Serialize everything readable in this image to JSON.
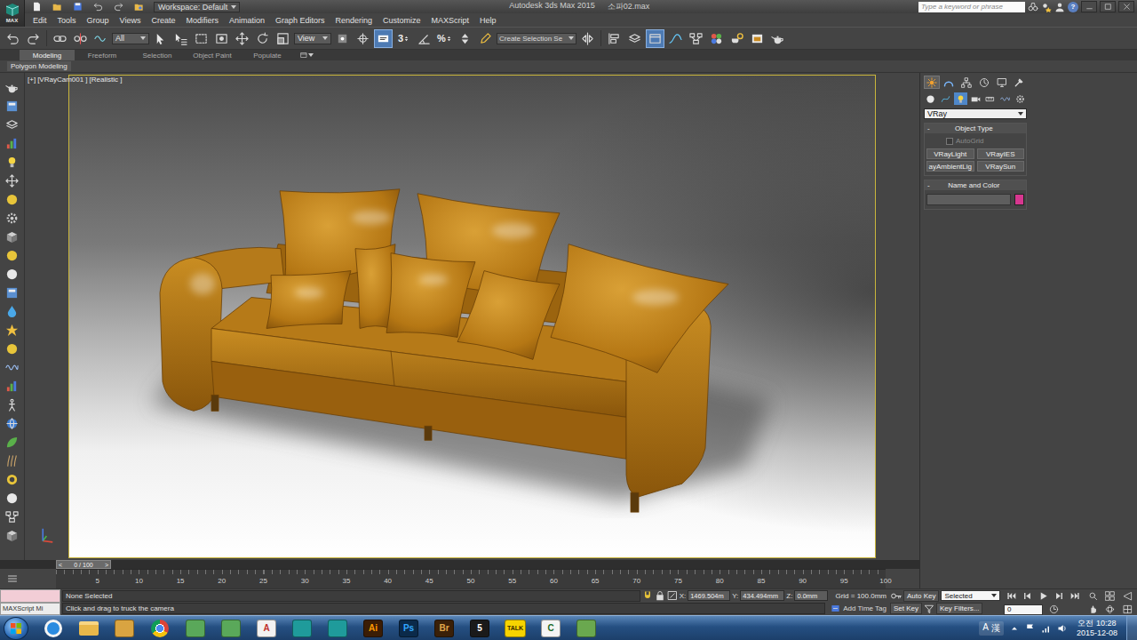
{
  "app_button": {
    "label": "MAX"
  },
  "title_bar": {
    "quick_access": [
      {
        "kind": "new"
      },
      {
        "kind": "open"
      },
      {
        "kind": "save"
      },
      {
        "kind": "undo"
      },
      {
        "kind": "redo"
      },
      {
        "kind": "project"
      }
    ],
    "workspace": "Workspace: Default",
    "title": "Autodesk 3ds Max  2015",
    "file": "소파02.max",
    "search_placeholder": "Type a keyword or phrase",
    "help": "?"
  },
  "menu": [
    "Edit",
    "Tools",
    "Group",
    "Views",
    "Create",
    "Modifiers",
    "Animation",
    "Graph Editors",
    "Rendering",
    "Customize",
    "MAXScript",
    "Help"
  ],
  "toolbar": [
    {
      "kind": "undo",
      "active": false
    },
    {
      "kind": "redo",
      "active": false
    },
    {
      "kind": "link",
      "active": false
    },
    {
      "kind": "unlink",
      "active": false
    },
    {
      "kind": "bind",
      "active": false
    },
    {
      "kind": "dropdown",
      "label": "All",
      "active": false
    },
    {
      "kind": "select",
      "active": false
    },
    {
      "kind": "select-name",
      "active": false
    },
    {
      "kind": "region",
      "active": false
    },
    {
      "kind": "crossing",
      "active": false
    },
    {
      "kind": "move",
      "active": false
    },
    {
      "kind": "rotate",
      "active": false
    },
    {
      "kind": "scale",
      "active": false
    },
    {
      "kind": "dropdown",
      "label": "View",
      "active": false
    },
    {
      "kind": "pivot",
      "active": false
    },
    {
      "kind": "manipulate",
      "active": false
    },
    {
      "kind": "keyboard",
      "active": true
    },
    {
      "kind": "snap",
      "label": "3",
      "active": false
    },
    {
      "kind": "angle-snap",
      "active": false
    },
    {
      "kind": "percent-snap",
      "label": "%",
      "active": false
    },
    {
      "kind": "spinner-snap",
      "active": false
    },
    {
      "kind": "named-sel",
      "active": false
    },
    {
      "kind": "field",
      "label": "Create Selection Se",
      "active": false
    },
    {
      "kind": "mirror",
      "active": false
    },
    {
      "kind": "align",
      "active": false
    },
    {
      "kind": "layers",
      "active": false
    },
    {
      "kind": "ribbon",
      "active": true
    },
    {
      "kind": "curve",
      "active": false
    },
    {
      "kind": "schematic",
      "active": false
    },
    {
      "kind": "material",
      "active": false
    },
    {
      "kind": "render-setup",
      "active": false
    },
    {
      "kind": "frame-window",
      "active": false
    },
    {
      "kind": "render",
      "active": false
    }
  ],
  "ribbon": {
    "tabs": [
      {
        "label": "Modeling",
        "selected": true
      },
      {
        "label": "Freeform",
        "selected": false
      },
      {
        "label": "Selection",
        "selected": false
      },
      {
        "label": "Object Paint",
        "selected": false
      },
      {
        "label": "Populate",
        "selected": false
      }
    ],
    "panel": "Polygon Modeling"
  },
  "left_tools": [
    {
      "kind": "teapot"
    },
    {
      "kind": "scene"
    },
    {
      "kind": "layers"
    },
    {
      "kind": "chart"
    },
    {
      "kind": "light"
    },
    {
      "kind": "move"
    },
    {
      "kind": "sphere-yellow"
    },
    {
      "kind": "gear"
    },
    {
      "kind": "box"
    },
    {
      "kind": "sphere-yellow"
    },
    {
      "kind": "sphere"
    },
    {
      "kind": "scene"
    },
    {
      "kind": "drop"
    },
    {
      "kind": "star"
    },
    {
      "kind": "sphere-yellow"
    },
    {
      "kind": "wave"
    },
    {
      "kind": "chart"
    },
    {
      "kind": "walk"
    },
    {
      "kind": "globe"
    },
    {
      "kind": "leaf"
    },
    {
      "kind": "hair"
    },
    {
      "kind": "torus"
    },
    {
      "kind": "sphere"
    },
    {
      "kind": "schematic"
    },
    {
      "kind": "box"
    }
  ],
  "viewport": {
    "labels": [
      "[+]",
      "[VRayCam001 ]",
      "[Realistic ]"
    ]
  },
  "command_panel": {
    "tabs": [
      {
        "kind": "create",
        "selected": true
      },
      {
        "kind": "modify",
        "selected": false
      },
      {
        "kind": "hierarchy",
        "selected": false
      },
      {
        "kind": "motion",
        "selected": false
      },
      {
        "kind": "display",
        "selected": false
      },
      {
        "kind": "utilities",
        "selected": false
      }
    ],
    "categories": [
      {
        "kind": "geometry",
        "selected": false
      },
      {
        "kind": "shapes",
        "selected": false
      },
      {
        "kind": "lights",
        "selected": true
      },
      {
        "kind": "cameras",
        "selected": false
      },
      {
        "kind": "helpers",
        "selected": false
      },
      {
        "kind": "spacewarps",
        "selected": false
      },
      {
        "kind": "systems",
        "selected": false
      }
    ],
    "dropdown": "VRay",
    "object_type": {
      "title": "Object Type",
      "toggle": "-",
      "expanded": true,
      "autogrid": {
        "label": "AutoGrid",
        "checked": false,
        "disabled": true
      },
      "buttons": [
        "VRayLight",
        "VRayIES",
        "ayAmbientLig",
        "VRaySun"
      ]
    },
    "name_color": {
      "title": "Name and Color",
      "toggle": "-",
      "expanded": true,
      "name": "",
      "color": "#d6378f"
    }
  },
  "time_slider": {
    "prev": "<",
    "label": "0 / 100",
    "next": ">",
    "level": 0
  },
  "track_bar": {
    "ticks": [
      "5",
      "10",
      "15",
      "20",
      "25",
      "30",
      "35",
      "40",
      "45",
      "50",
      "55",
      "60",
      "65",
      "70",
      "75",
      "80",
      "85",
      "90",
      "95",
      "100"
    ]
  },
  "status": {
    "listener": "MAXScript Mi",
    "selection": "None Selected",
    "prompt": "Click and drag to truck the camera",
    "x_label": "X:",
    "x": "1469.504m",
    "y_label": "Y:",
    "y": "434.494mm",
    "z_label": "Z:",
    "z": "0.0mm",
    "grid": "Grid = 100.0mm",
    "add_time_tag": "Add Time Tag",
    "auto_key": {
      "label": "Auto Key",
      "on": false
    },
    "set_key": "Set Key",
    "key_mode": "Selected",
    "key_filters": "Key Filters...",
    "frame": "0"
  },
  "taskbar": {
    "apps": [
      {
        "kind": "ie",
        "color": "#2a8be0"
      },
      {
        "kind": "folder",
        "color": "#e8b84a"
      },
      {
        "kind": "package",
        "color": "#d9a441"
      },
      {
        "kind": "chrome",
        "color": "#4caf50"
      },
      {
        "kind": "square",
        "color": "#5aa85a"
      },
      {
        "kind": "square",
        "color": "#5aa85a"
      },
      {
        "kind": "letter",
        "label": "A",
        "color": "#f2f2f2",
        "text_color": "#c0302b"
      },
      {
        "kind": "square",
        "color": "#1f9b9b"
      },
      {
        "kind": "square",
        "color": "#1f9b9b"
      },
      {
        "kind": "letter",
        "label": "Ai",
        "color": "#3b1d05",
        "text_color": "#ff9a00"
      },
      {
        "kind": "letter",
        "label": "Ps",
        "color": "#0b2a4a",
        "text_color": "#31a8ff"
      },
      {
        "kind": "letter",
        "label": "Br",
        "color": "#3a2008",
        "text_color": "#e0a64a"
      },
      {
        "kind": "letter",
        "label": "5",
        "color": "#1a1a1a",
        "text_color": "#ffffff"
      },
      {
        "kind": "letter",
        "label": "TALK",
        "color": "#f7d400",
        "text_color": "#3a2a00"
      },
      {
        "kind": "letter",
        "label": "C",
        "color": "#f4f4f4",
        "text_color": "#1d6b2a"
      },
      {
        "kind": "square",
        "color": "#6aa84f"
      }
    ],
    "ime": [
      "A",
      "漢"
    ],
    "time": "오전 10:28",
    "date": "2015-12-08"
  }
}
